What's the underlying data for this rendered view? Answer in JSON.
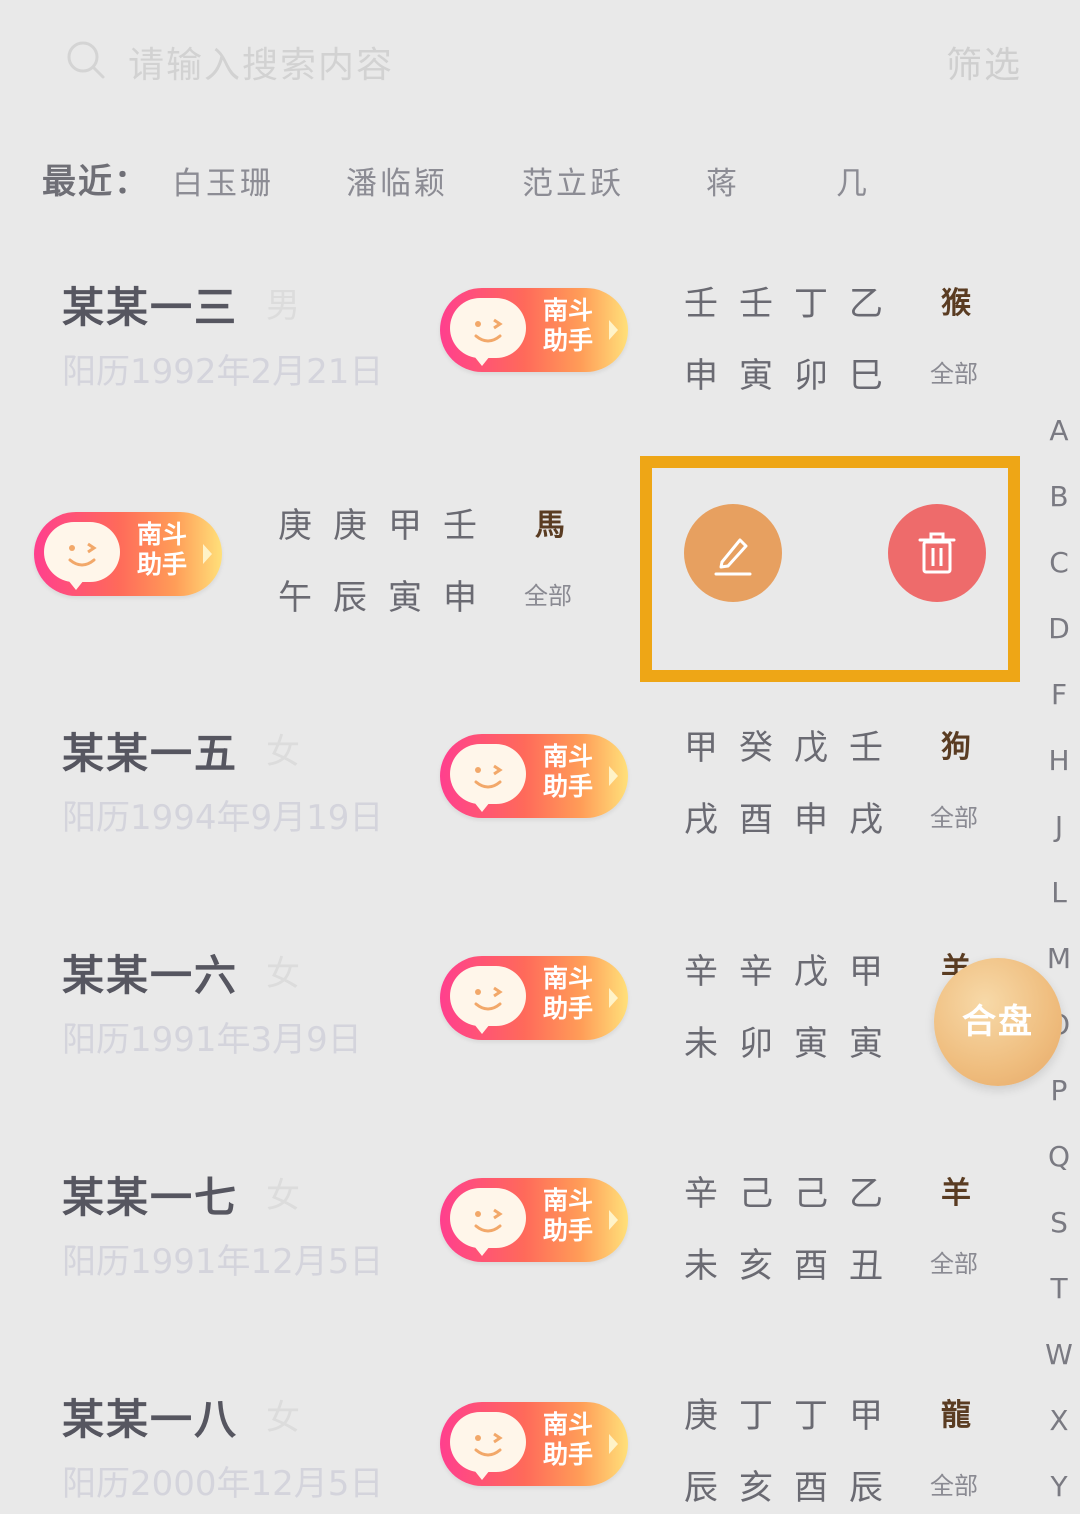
{
  "search": {
    "placeholder": "请输入搜索内容",
    "filter_label": "筛选"
  },
  "recent": {
    "label": "最近：",
    "items": [
      "白玉珊",
      "潘临颖",
      "范立跃",
      "蒋",
      "几"
    ]
  },
  "badge": {
    "line1": "南斗",
    "line2": "助手"
  },
  "records": [
    {
      "name": "某某一三",
      "gender": "男",
      "date": "阳历1992年2月21日",
      "stems": [
        "壬",
        "壬",
        "丁",
        "乙"
      ],
      "branches": [
        "申",
        "寅",
        "卯",
        "巳"
      ],
      "zodiac": "猴",
      "all": "全部"
    },
    {
      "name": "",
      "gender": "",
      "date": "",
      "stems": [
        "庚",
        "庚",
        "甲",
        "壬"
      ],
      "branches": [
        "午",
        "辰",
        "寅",
        "申"
      ],
      "zodiac": "馬",
      "all": "全部"
    },
    {
      "name": "某某一五",
      "gender": "女",
      "date": "阳历1994年9月19日",
      "stems": [
        "甲",
        "癸",
        "戊",
        "壬"
      ],
      "branches": [
        "戌",
        "酉",
        "申",
        "戌"
      ],
      "zodiac": "狗",
      "all": "全部"
    },
    {
      "name": "某某一六",
      "gender": "女",
      "date": "阳历1991年3月9日",
      "stems": [
        "辛",
        "辛",
        "戊",
        "甲"
      ],
      "branches": [
        "未",
        "卯",
        "寅",
        "寅"
      ],
      "zodiac": "羊",
      "all": ""
    },
    {
      "name": "某某一七",
      "gender": "女",
      "date": "阳历1991年12月5日",
      "stems": [
        "辛",
        "己",
        "己",
        "乙"
      ],
      "branches": [
        "未",
        "亥",
        "酉",
        "丑"
      ],
      "zodiac": "羊",
      "all": "全部"
    },
    {
      "name": "某某一八",
      "gender": "女",
      "date": "阳历2000年12月5日",
      "stems": [
        "庚",
        "丁",
        "丁",
        "甲"
      ],
      "branches": [
        "辰",
        "亥",
        "酉",
        "辰"
      ],
      "zodiac": "龍",
      "all": "全部"
    }
  ],
  "alphabet": [
    "A",
    "B",
    "C",
    "D",
    "F",
    "H",
    "J",
    "L",
    "M",
    "O",
    "P",
    "Q",
    "S",
    "T",
    "W",
    "X",
    "Y"
  ],
  "fab": {
    "label": "合盘"
  },
  "actions": {
    "edit_icon": "pencil-icon",
    "delete_icon": "trash-icon"
  },
  "colors": {
    "badge_start": "#ff3f8e",
    "badge_end": "#ffe07a",
    "edit": "#e7a060",
    "delete": "#ee6b6b",
    "highlight": "#eea616"
  }
}
